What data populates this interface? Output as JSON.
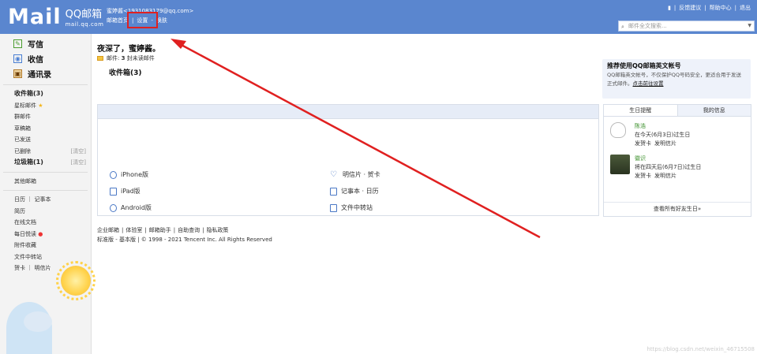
{
  "header": {
    "logo_text": "Mail",
    "logo_cn": "QQ邮箱",
    "logo_site": "mail.qq.com",
    "user_line": "蜜婷酱<1931083179@qq.com>",
    "links": [
      "邮箱首页",
      "|",
      "设置",
      "-",
      "换肤"
    ],
    "top_links": [
      "|",
      "反馈建议",
      "|",
      "帮助中心",
      "|",
      "退出"
    ],
    "search_placeholder": "邮件全文搜索...",
    "accent": "#5a86cf"
  },
  "sidebar": {
    "big_items": [
      {
        "label": "写信",
        "icon": "pencil-icon"
      },
      {
        "label": "收信",
        "icon": "inbox-icon"
      },
      {
        "label": "通讯录",
        "icon": "contacts-icon"
      }
    ],
    "folders": [
      {
        "label": "收件箱(3)",
        "bold": true
      },
      {
        "label": "星标邮件",
        "star": "★"
      },
      {
        "label": "群邮件"
      },
      {
        "label": "草稿箱"
      },
      {
        "label": "已发送"
      },
      {
        "label": "已删除",
        "action": "[清空]"
      },
      {
        "label": "垃圾箱(1)",
        "bold": true,
        "action": "[清空]"
      }
    ],
    "other_folders": "其他邮箱",
    "apps": [
      {
        "label": "日历 ｜ 记事本"
      },
      {
        "label": "简历"
      },
      {
        "label": "在线文档"
      },
      {
        "label": "每日悦读",
        "dot": "●"
      },
      {
        "label": "附件收藏"
      },
      {
        "label": "文件中转站"
      },
      {
        "label": "贺卡 ｜ 明信片"
      }
    ]
  },
  "main": {
    "greeting": "夜深了，蜜婷酱。",
    "unread_prefix": "邮件:",
    "unread_count": "3",
    "unread_suffix": "封未读邮件",
    "inbox_link": "收件箱(3)",
    "promo_title": "推荐使用QQ邮箱英文帐号",
    "promo_text": "QQ邮箱英文帐号，不仅保护QQ号码安全，更适合用于发送正式邮件。",
    "promo_link": "点击前往设置",
    "apps": [
      {
        "label": "iPhone版",
        "icon": "apple-icon"
      },
      {
        "label": "明信片 · 贺卡",
        "icon": "heart-icon"
      },
      {
        "label": "iPad版",
        "icon": "ipad-icon"
      },
      {
        "label": "记事本 · 日历",
        "icon": "calendar-icon"
      },
      {
        "label": "Android版",
        "icon": "android-icon"
      },
      {
        "label": "文件中转站",
        "icon": "file-transfer-icon"
      }
    ],
    "birthday": {
      "tabs": [
        "生日提醒",
        "我的信息"
      ],
      "people": [
        {
          "name": "陈浩",
          "desc": "在今天(6月3日)过生日",
          "actions": [
            "发贺卡",
            "发明信片"
          ]
        },
        {
          "name": "徽识",
          "desc": "将在四天后(6月7日)过生日",
          "actions": [
            "发贺卡",
            "发明信片"
          ]
        }
      ],
      "footer": "查看所有好友生日»"
    },
    "footer_links": [
      "企业邮箱",
      "|",
      "体验室",
      "|",
      "邮箱助手",
      "|",
      "自助查询",
      "|",
      "隐私政策"
    ],
    "footer_copy": "标准版 - 基本版 | © 1998 - 2021 Tencent Inc. All Rights Reserved"
  },
  "annotation": {
    "color": "#e02020"
  },
  "watermark": "https://blog.csdn.net/weixin_46715508"
}
